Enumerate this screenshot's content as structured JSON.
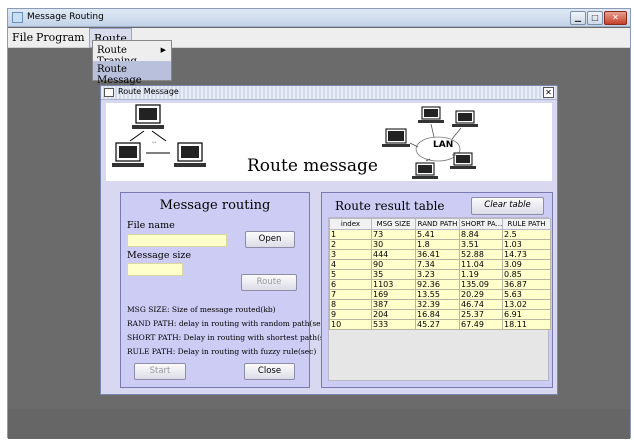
{
  "window": {
    "title": "Message Routing"
  },
  "menubar": {
    "file": "File",
    "program": "Program",
    "route": "Route"
  },
  "route_menu": {
    "items": [
      "Route Traning",
      "Route Message"
    ]
  },
  "dialog": {
    "title": "Route Message",
    "banner_title": "Route message",
    "lan_label": "LAN"
  },
  "left_panel": {
    "heading": "Message routing",
    "file_name_label": "File name",
    "file_name_value": "",
    "message_size_label": "Message size",
    "message_size_value": "",
    "open_button": "Open",
    "route_button": "Route",
    "legend": [
      "MSG SIZE: Size of message routed(kb)",
      "RAND PATH: delay in routing with random path(sec)",
      "SHORT PATH: Delay in routing with shortest path(sec)",
      "RULE PATH: Delay in routing with fuzzy rule(sec)"
    ],
    "start_button": "Start",
    "close_button": "Close"
  },
  "right_panel": {
    "heading": "Route result table",
    "clear_button": "Clear table",
    "table": {
      "headers": [
        "index",
        "MSG SIZE",
        "RAND PATH",
        "SHORT PA...",
        "RULE PATH"
      ],
      "rows": [
        [
          "1",
          "73",
          "5.41",
          "8.84",
          "2.5"
        ],
        [
          "2",
          "30",
          "1.8",
          "3.51",
          "1.03"
        ],
        [
          "3",
          "444",
          "36.41",
          "52.88",
          "14.73"
        ],
        [
          "4",
          "90",
          "7.34",
          "11.04",
          "3.09"
        ],
        [
          "5",
          "35",
          "3.23",
          "1.19",
          "0.85"
        ],
        [
          "6",
          "1103",
          "92.36",
          "135.09",
          "36.87"
        ],
        [
          "7",
          "169",
          "13.55",
          "20.29",
          "5.63"
        ],
        [
          "8",
          "387",
          "32.39",
          "46.74",
          "13.02"
        ],
        [
          "9",
          "204",
          "16.84",
          "25.37",
          "6.91"
        ],
        [
          "10",
          "533",
          "45.27",
          "67.49",
          "18.11"
        ]
      ]
    }
  }
}
